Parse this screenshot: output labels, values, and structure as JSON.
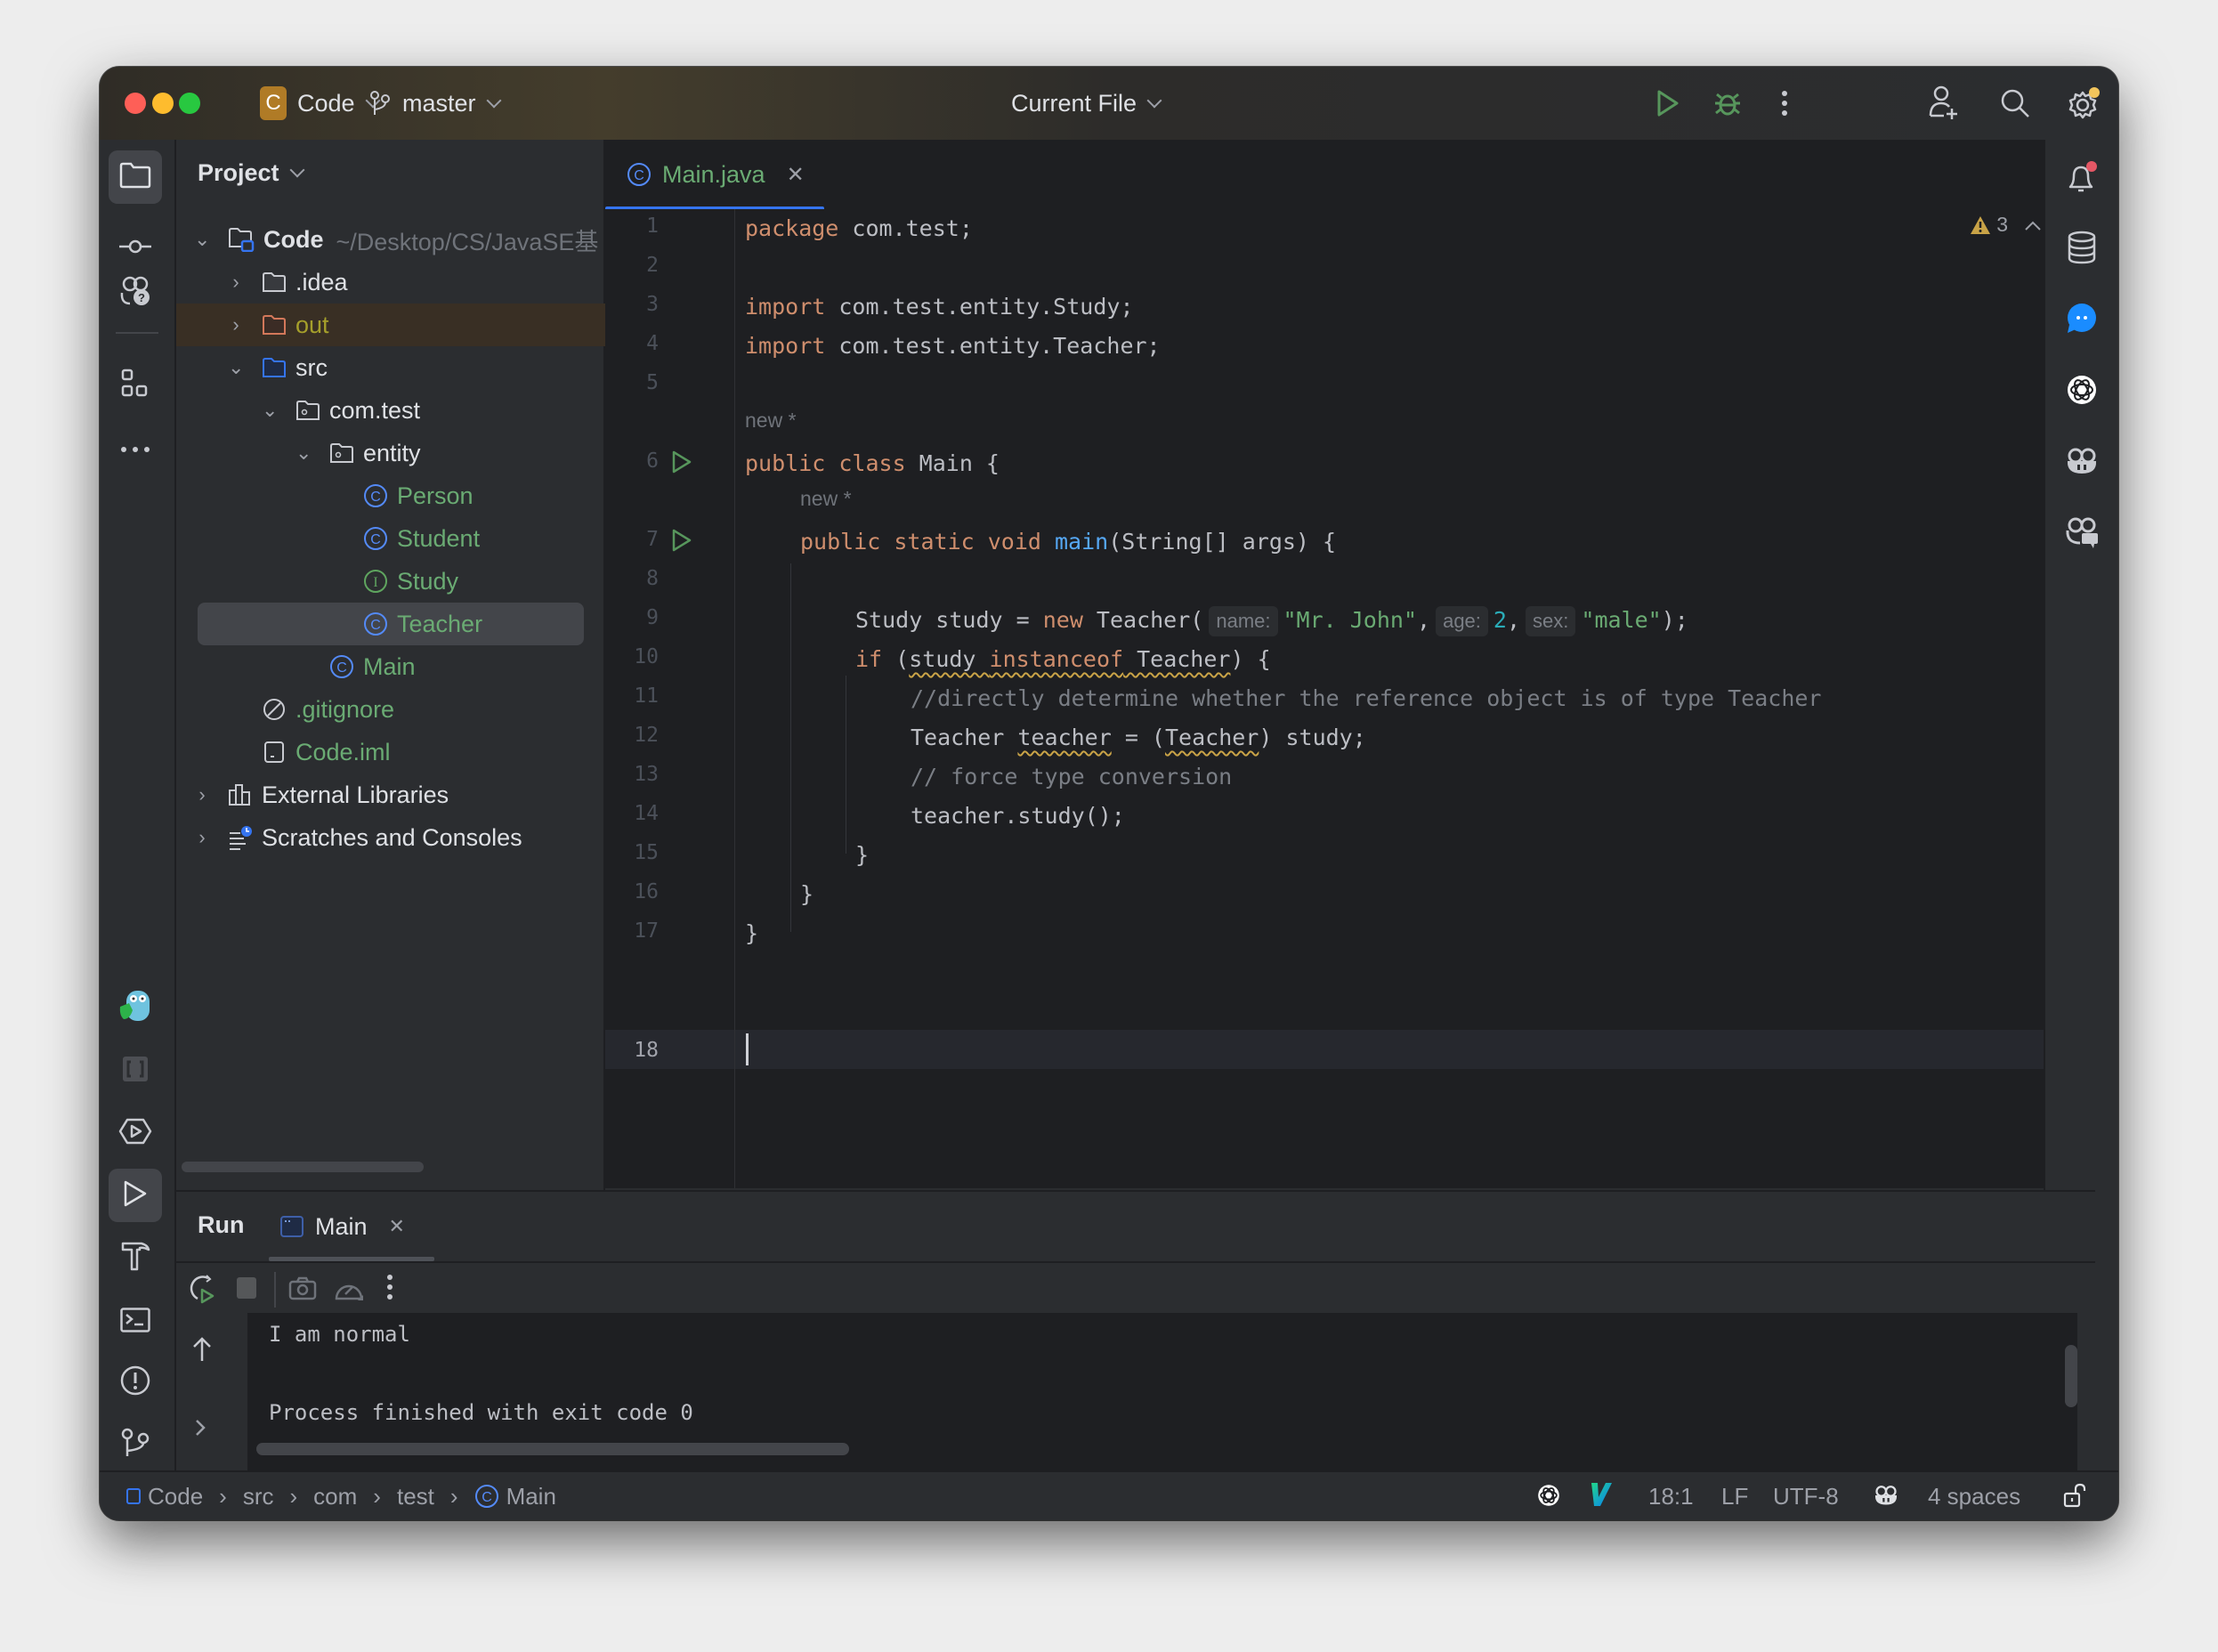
{
  "titlebar": {
    "project_badge": "C",
    "project_name": "Code",
    "branch": "master",
    "run_config": "Current File"
  },
  "project_panel": {
    "title": "Project",
    "tree": [
      {
        "label": "Code",
        "suffix": "~/Desktop/CS/JavaSE基",
        "depth": 0,
        "expanded": true,
        "type": "module"
      },
      {
        "label": ".idea",
        "depth": 1,
        "expanded": false,
        "type": "folder"
      },
      {
        "label": "out",
        "depth": 1,
        "expanded": false,
        "type": "excluded-folder"
      },
      {
        "label": "src",
        "depth": 1,
        "expanded": true,
        "type": "source-folder"
      },
      {
        "label": "com.test",
        "depth": 2,
        "expanded": true,
        "type": "package"
      },
      {
        "label": "entity",
        "depth": 3,
        "expanded": true,
        "type": "package"
      },
      {
        "label": "Person",
        "depth": 4,
        "type": "class"
      },
      {
        "label": "Student",
        "depth": 4,
        "type": "class"
      },
      {
        "label": "Study",
        "depth": 4,
        "type": "interface"
      },
      {
        "label": "Teacher",
        "depth": 4,
        "type": "class",
        "selected": true
      },
      {
        "label": "Main",
        "depth": 3,
        "type": "class"
      },
      {
        "label": ".gitignore",
        "depth": 1,
        "type": "ignore-file"
      },
      {
        "label": "Code.iml",
        "depth": 1,
        "type": "iml-file"
      },
      {
        "label": "External Libraries",
        "depth": 0,
        "expanded": false,
        "type": "libraries"
      },
      {
        "label": "Scratches and Consoles",
        "depth": 0,
        "expanded": false,
        "type": "scratches"
      }
    ]
  },
  "editor": {
    "tab_label": "Main.java",
    "warnings_count": "3",
    "lens_new": "new *",
    "lines": {
      "l1_kw": "package",
      "l1_rest": " com.test;",
      "l3_kw": "import",
      "l3_rest": " com.test.entity.Study;",
      "l4_kw": "import",
      "l4_rest": " com.test.entity.Teacher;",
      "l6_kw": "public class",
      "l6_rest": " Main {",
      "l7_kw": "public static void",
      "l7_fn": "main",
      "l7_rest": "(String[] args) {",
      "l9_a": "Study study = ",
      "l9_kw": "new",
      "l9_b": " Teacher(",
      "l9_hint1": "name:",
      "l9_str1": "\"Mr. John\"",
      "l9_c": ",",
      "l9_hint2": "age:",
      "l9_num": "2",
      "l9_d": ",",
      "l9_hint3": "sex:",
      "l9_str2": "\"male\"",
      "l9_e": ");",
      "l10_kw": "if",
      "l10_a": " (",
      "l10_sq1": "study ",
      "l10_kw2": "instanceof",
      "l10_sq2": " Teacher",
      "l10_b": ") {",
      "l11": "//directly determine whether the reference object is of type Teacher",
      "l12_a": "Teacher ",
      "l12_sq1": "teacher",
      "l12_b": " = (",
      "l12_sq2": "Teacher",
      "l12_c": ") study;",
      "l13": "// force type conversion",
      "l14": "teacher.study();",
      "l15": "}",
      "l16": "}",
      "l17": "}"
    },
    "line_numbers": [
      "1",
      "2",
      "3",
      "4",
      "5",
      "6",
      "7",
      "8",
      "9",
      "10",
      "11",
      "12",
      "13",
      "14",
      "15",
      "16",
      "17",
      "18"
    ]
  },
  "run_panel": {
    "title": "Run",
    "tab_label": "Main",
    "output": [
      "I am normal",
      "",
      "Process finished with exit code 0"
    ]
  },
  "status_bar": {
    "breadcrumb": [
      "Code",
      "src",
      "com",
      "test",
      "Main"
    ],
    "position": "18:1",
    "line_ending": "LF",
    "encoding": "UTF-8",
    "indent": "4 spaces"
  }
}
